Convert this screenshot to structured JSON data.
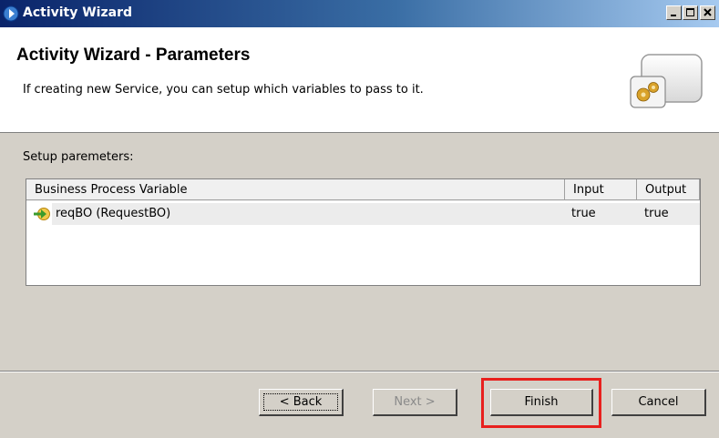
{
  "window": {
    "title": "Activity Wizard",
    "controls": [
      "minimize",
      "maximize",
      "close"
    ]
  },
  "header": {
    "heading": "Activity Wizard - Parameters",
    "description": "If creating new Service, you can setup which variables to pass to it."
  },
  "main": {
    "setup_label": "Setup paremeters:",
    "table": {
      "columns": [
        "Business Process Variable",
        "Input",
        "Output"
      ],
      "rows": [
        {
          "variable": "reqBO (RequestBO)",
          "input": "true",
          "output": "true"
        }
      ]
    }
  },
  "footer": {
    "back_label": "< Back",
    "next_label": "Next >",
    "finish_label": "Finish",
    "cancel_label": "Cancel"
  },
  "colors": {
    "title_bar": "#0a246a",
    "highlight": "#e8201e"
  }
}
